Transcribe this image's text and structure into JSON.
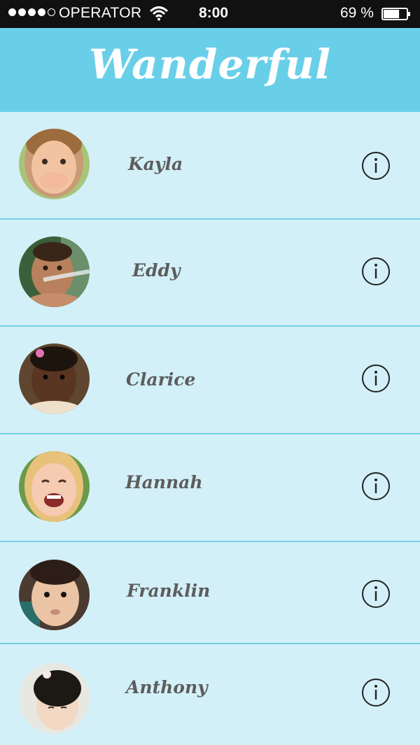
{
  "status_bar": {
    "carrier": "OPERATOR",
    "time": "8:00",
    "battery": "69 %",
    "battery_level": 0.69,
    "signal_strength": 4,
    "signal_max": 5
  },
  "header": {
    "title": "Wanderful",
    "background_color": "#69cfe9"
  },
  "list": {
    "background_color": "#d3f0f8",
    "divider_color": "#72cfe2",
    "items": [
      {
        "name": "Kayla",
        "info_icon": "info-icon"
      },
      {
        "name": "Eddy",
        "info_icon": "info-icon"
      },
      {
        "name": "Clarice",
        "info_icon": "info-icon"
      },
      {
        "name": "Hannah",
        "info_icon": "info-icon"
      },
      {
        "name": "Franklin",
        "info_icon": "info-icon"
      },
      {
        "name": "Anthony",
        "info_icon": "info-icon"
      }
    ]
  }
}
